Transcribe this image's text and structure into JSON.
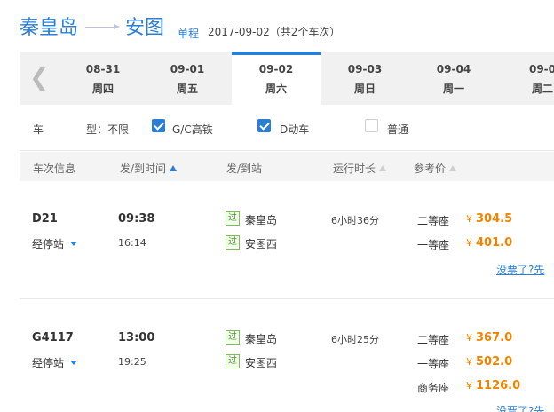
{
  "route": {
    "from": "秦皇岛",
    "to": "安图",
    "trip_type": "单程",
    "summary": "2017-09-02（共2个车次）"
  },
  "date_tabs": [
    {
      "date": "08-31",
      "weekday": "周四"
    },
    {
      "date": "09-01",
      "weekday": "周五"
    },
    {
      "date": "09-02",
      "weekday": "周六"
    },
    {
      "date": "09-03",
      "weekday": "周日"
    },
    {
      "date": "09-04",
      "weekday": "周一"
    },
    {
      "date": "09-0",
      "weekday": "周二"
    }
  ],
  "filters": {
    "label": "车",
    "type_label": "型：不限",
    "options": [
      {
        "label": "G/C高铁",
        "checked": true
      },
      {
        "label": "D动车",
        "checked": true
      },
      {
        "label": "普通",
        "checked": false
      }
    ]
  },
  "table_headers": {
    "train": "车次信息",
    "time": "发/到时间",
    "station": "发/到站",
    "duration": "运行时长",
    "price": "参考价"
  },
  "trains": [
    {
      "number": "D21",
      "stops_label": "经停站",
      "depart_time": "09:38",
      "arrive_time": "16:14",
      "depart_badge": "过",
      "depart_station": "秦皇岛",
      "arrive_badge": "过",
      "arrive_station": "安图西",
      "duration": "6小时36分",
      "seats": [
        {
          "name": "二等座",
          "currency": "¥",
          "price": "304.5"
        },
        {
          "name": "一等座",
          "currency": "¥",
          "price": "401.0"
        }
      ],
      "sold_out_text": "没票了?先"
    },
    {
      "number": "G4117",
      "stops_label": "经停站",
      "depart_time": "13:00",
      "arrive_time": "19:25",
      "depart_badge": "过",
      "depart_station": "秦皇岛",
      "arrive_badge": "过",
      "arrive_station": "安图西",
      "duration": "6小时25分",
      "seats": [
        {
          "name": "二等座",
          "currency": "¥",
          "price": "367.0"
        },
        {
          "name": "一等座",
          "currency": "¥",
          "price": "502.0"
        },
        {
          "name": "商务座",
          "currency": "¥",
          "price": "1126.0"
        }
      ],
      "sold_out_text": "没票了?先"
    }
  ],
  "colors": {
    "accent": "#2a7fd4",
    "price": "#f08300",
    "badge_green": "#4a9a2a"
  }
}
